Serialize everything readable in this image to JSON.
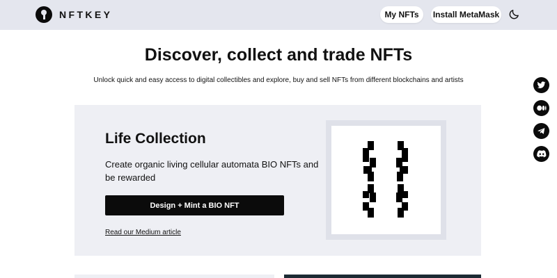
{
  "header": {
    "logo_text": "NFTKEY",
    "my_nfts_label": "My NFTs",
    "install_metamask_label": "Install MetaMask",
    "theme_icon": "moon-icon"
  },
  "hero": {
    "title": "Discover, collect and trade NFTs",
    "subtitle": "Unlock quick and easy access to digital collectibles and explore, buy and sell NFTs from different blockchains and artists"
  },
  "socials": [
    "twitter-icon",
    "medium-icon",
    "telegram-icon",
    "discord-icon"
  ],
  "feature_card": {
    "title": "Life Collection",
    "description": "Create organic living cellular automata BIO NFTs and be rewarded",
    "cta_label": "Design + Mint a BIO NFT",
    "link_label": "Read our Medium article"
  },
  "colors": {
    "header_bg": "#e4e6ee",
    "card_bg": "#eeeff4",
    "primary": "#0b0b0b"
  }
}
